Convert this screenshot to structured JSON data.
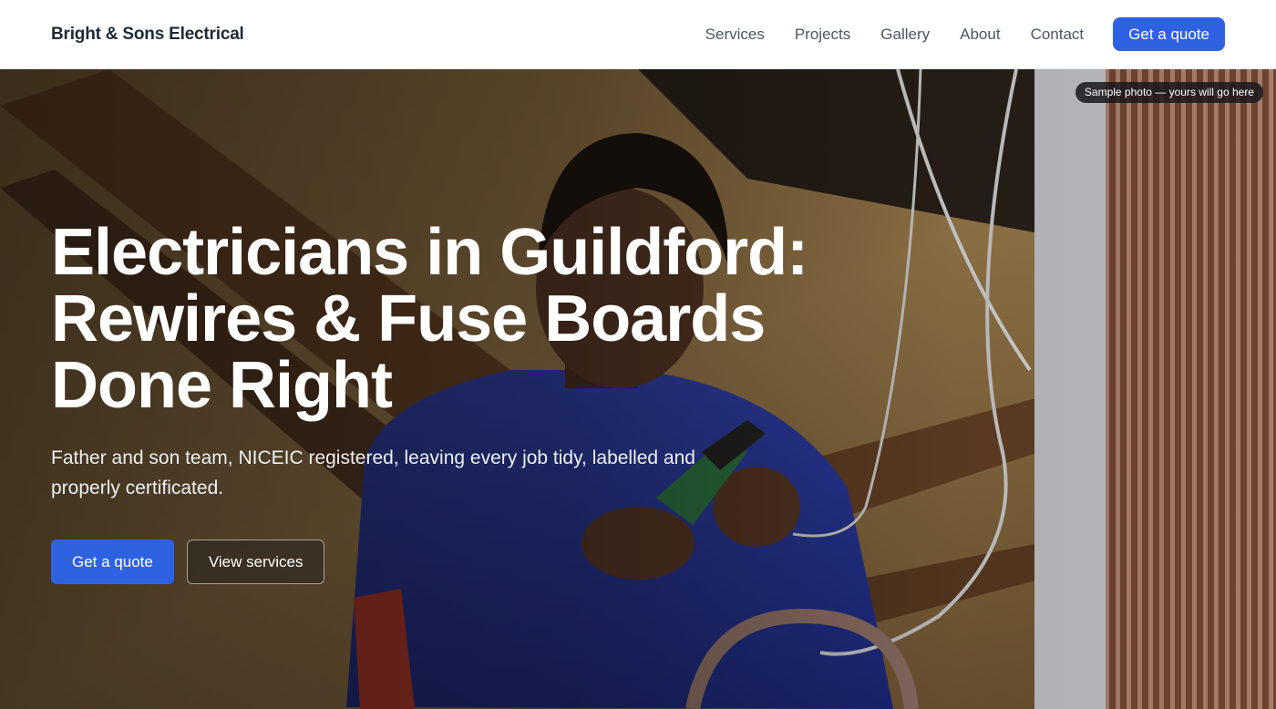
{
  "header": {
    "brand": "Bright & Sons Electrical",
    "nav": [
      {
        "label": "Services"
      },
      {
        "label": "Projects"
      },
      {
        "label": "Gallery"
      },
      {
        "label": "About"
      },
      {
        "label": "Contact"
      }
    ],
    "cta_label": "Get a quote"
  },
  "hero": {
    "photo_badge": "Sample photo — yours will go here",
    "title_lines": [
      "Electricians in Guildford:",
      "Rewires & Fuse Boards",
      "Done Right"
    ],
    "subtitle": "Father and son team, NICEIC registered, leaving every job tidy, labelled and properly certificated.",
    "primary_button": "Get a quote",
    "secondary_button": "View services"
  },
  "colors": {
    "accent": "#2f62e3",
    "header_bg": "#ffffff",
    "text_dark": "#1f2937",
    "nav_text": "#4b5563"
  }
}
